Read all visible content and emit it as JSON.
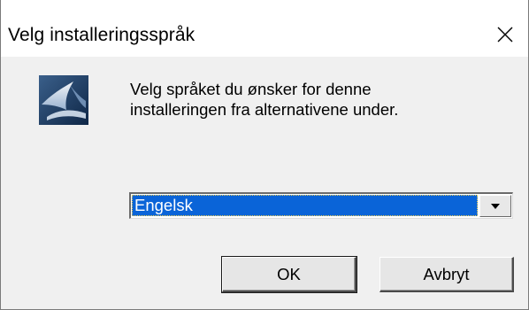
{
  "window": {
    "title": "Velg installeringsspråk",
    "close_icon": "close-icon"
  },
  "content": {
    "logo_icon": "installer-logo-icon",
    "message_line1": "Velg språket du ønsker for denne",
    "message_line2": "installeringen fra alternativene under."
  },
  "language_select": {
    "selected": "Engelsk",
    "arrow_icon": "dropdown-arrow-icon"
  },
  "buttons": {
    "ok_label": "OK",
    "cancel_label": "Avbryt"
  },
  "colors": {
    "selection": "#0a64d8",
    "window_bg": "#f0f0f0",
    "titlebar_bg": "#ffffff"
  }
}
